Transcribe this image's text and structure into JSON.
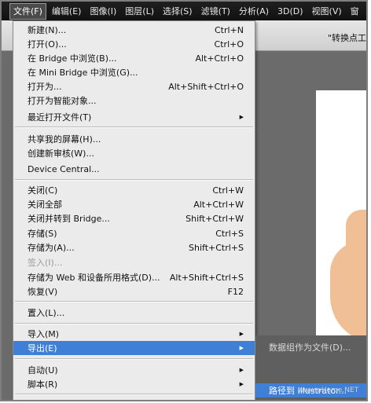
{
  "menubar": {
    "items": [
      "文件(F)",
      "编辑(E)",
      "图像(I)",
      "图层(L)",
      "选择(S)",
      "滤镜(T)",
      "分析(A)",
      "3D(D)",
      "视图(V)",
      "窗"
    ]
  },
  "optionsbar": {
    "text": "\"转换点工"
  },
  "file_menu": {
    "items": [
      {
        "label": "新建(N)...",
        "shortcut": "Ctrl+N"
      },
      {
        "label": "打开(O)...",
        "shortcut": "Ctrl+O"
      },
      {
        "label": "在 Bridge 中浏览(B)...",
        "shortcut": "Alt+Ctrl+O"
      },
      {
        "label": "在 Mini Bridge 中浏览(G)...",
        "shortcut": ""
      },
      {
        "label": "打开为...",
        "shortcut": "Alt+Shift+Ctrl+O"
      },
      {
        "label": "打开为智能对象...",
        "shortcut": ""
      },
      {
        "label": "最近打开文件(T)",
        "shortcut": ""
      },
      {
        "label": "共享我的屏幕(H)...",
        "shortcut": ""
      },
      {
        "label": "创建新审核(W)...",
        "shortcut": ""
      },
      {
        "label": "Device Central...",
        "shortcut": ""
      },
      {
        "label": "关闭(C)",
        "shortcut": "Ctrl+W"
      },
      {
        "label": "关闭全部",
        "shortcut": "Alt+Ctrl+W"
      },
      {
        "label": "关闭并转到 Bridge...",
        "shortcut": "Shift+Ctrl+W"
      },
      {
        "label": "存储(S)",
        "shortcut": "Ctrl+S"
      },
      {
        "label": "存储为(A)...",
        "shortcut": "Shift+Ctrl+S"
      },
      {
        "label": "签入(I)...",
        "shortcut": ""
      },
      {
        "label": "存储为 Web 和设备所用格式(D)...",
        "shortcut": "Alt+Shift+Ctrl+S"
      },
      {
        "label": "恢复(V)",
        "shortcut": "F12"
      },
      {
        "label": "置入(L)...",
        "shortcut": ""
      },
      {
        "label": "导入(M)",
        "shortcut": ""
      },
      {
        "label": "导出(E)",
        "shortcut": ""
      },
      {
        "label": "自动(U)",
        "shortcut": ""
      },
      {
        "label": "脚本(R)",
        "shortcut": ""
      }
    ]
  },
  "export_submenu": {
    "items": [
      "数据组作为文件(D)...",
      "路径到 Illustrator..."
    ]
  },
  "watermark": "www.pHome.NET",
  "colors": {
    "menu_highlight": "#3f7fd6",
    "menu_bg": "#ebebeb",
    "menubar_bg": "#1f1f1f",
    "skin": "#f0bf96"
  }
}
